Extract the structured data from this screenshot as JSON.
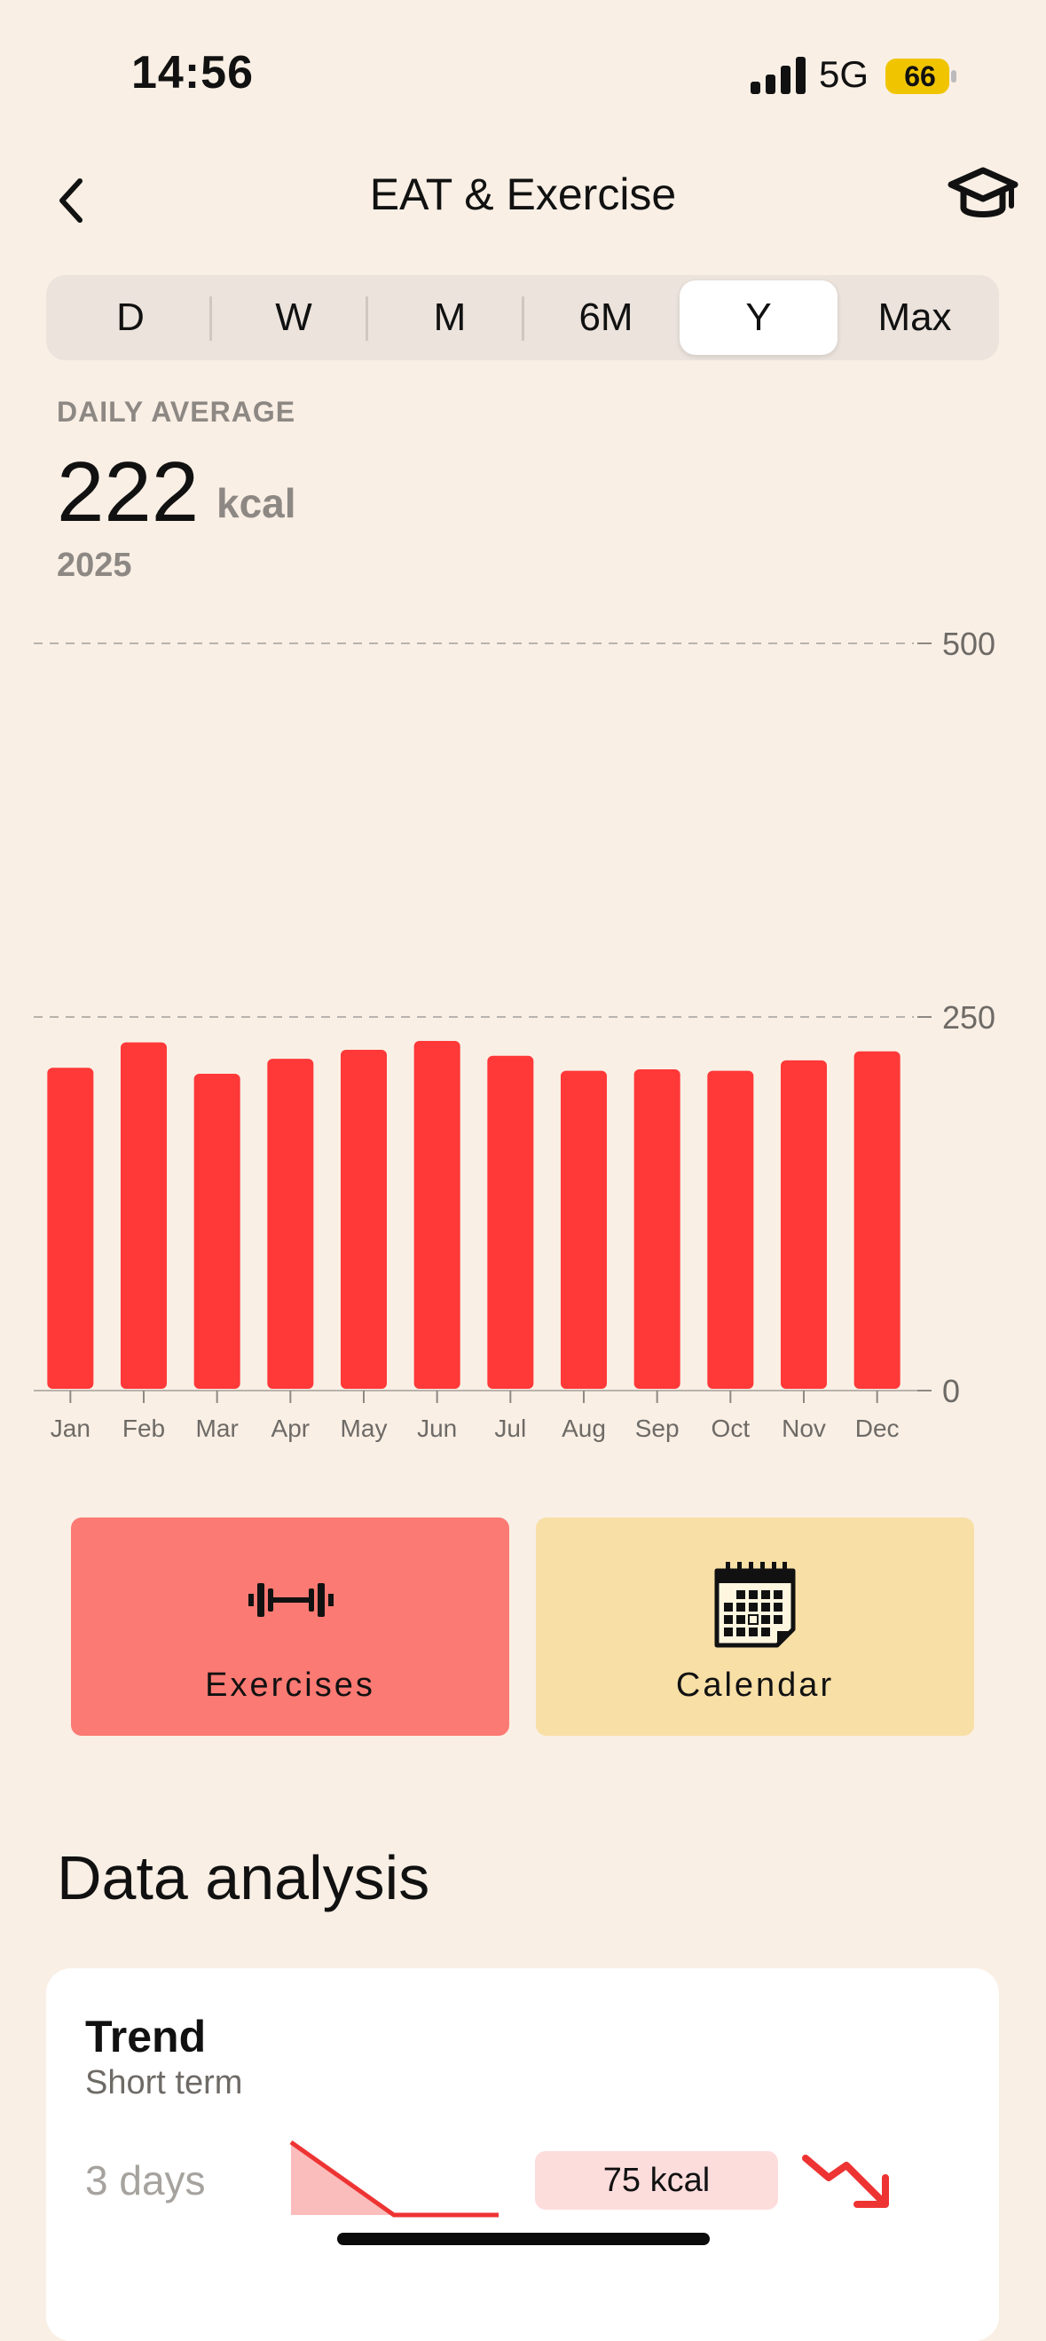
{
  "status_bar": {
    "time": "14:56",
    "network": "5G",
    "battery": "66"
  },
  "nav": {
    "title": "EAT & Exercise"
  },
  "segments": [
    {
      "label": "D",
      "active": false
    },
    {
      "label": "W",
      "active": false
    },
    {
      "label": "M",
      "active": false
    },
    {
      "label": "6M",
      "active": false
    },
    {
      "label": "Y",
      "active": true
    },
    {
      "label": "Max",
      "active": false
    }
  ],
  "summary": {
    "label": "DAILY AVERAGE",
    "value": "222",
    "unit": "kcal",
    "period": "2025"
  },
  "chart_data": {
    "type": "bar",
    "categories": [
      "Jan",
      "Feb",
      "Mar",
      "Apr",
      "May",
      "Jun",
      "Jul",
      "Aug",
      "Sep",
      "Oct",
      "Nov",
      "Dec"
    ],
    "values": [
      216,
      233,
      212,
      222,
      228,
      234,
      224,
      214,
      215,
      214,
      221,
      227
    ],
    "ylim": [
      0,
      500
    ],
    "yticks": [
      "0",
      "250",
      "500"
    ],
    "grid": "dashed at 250 and 500",
    "color": "#ff3838"
  },
  "cards": {
    "exercises": {
      "label": "Exercises",
      "icon": "dumbbell-icon"
    },
    "calendar": {
      "label": "Calendar",
      "icon": "calendar-icon"
    }
  },
  "analysis": {
    "title": "Data analysis",
    "trend": {
      "title": "Trend",
      "subtitle": "Short term",
      "period": "3 days",
      "value": "75 kcal",
      "direction": "down"
    }
  },
  "colors": {
    "background": "#f9efe5",
    "accent": "#ff3838",
    "exercise_card": "#fb7a73",
    "calendar_card": "#f8dfa6"
  }
}
